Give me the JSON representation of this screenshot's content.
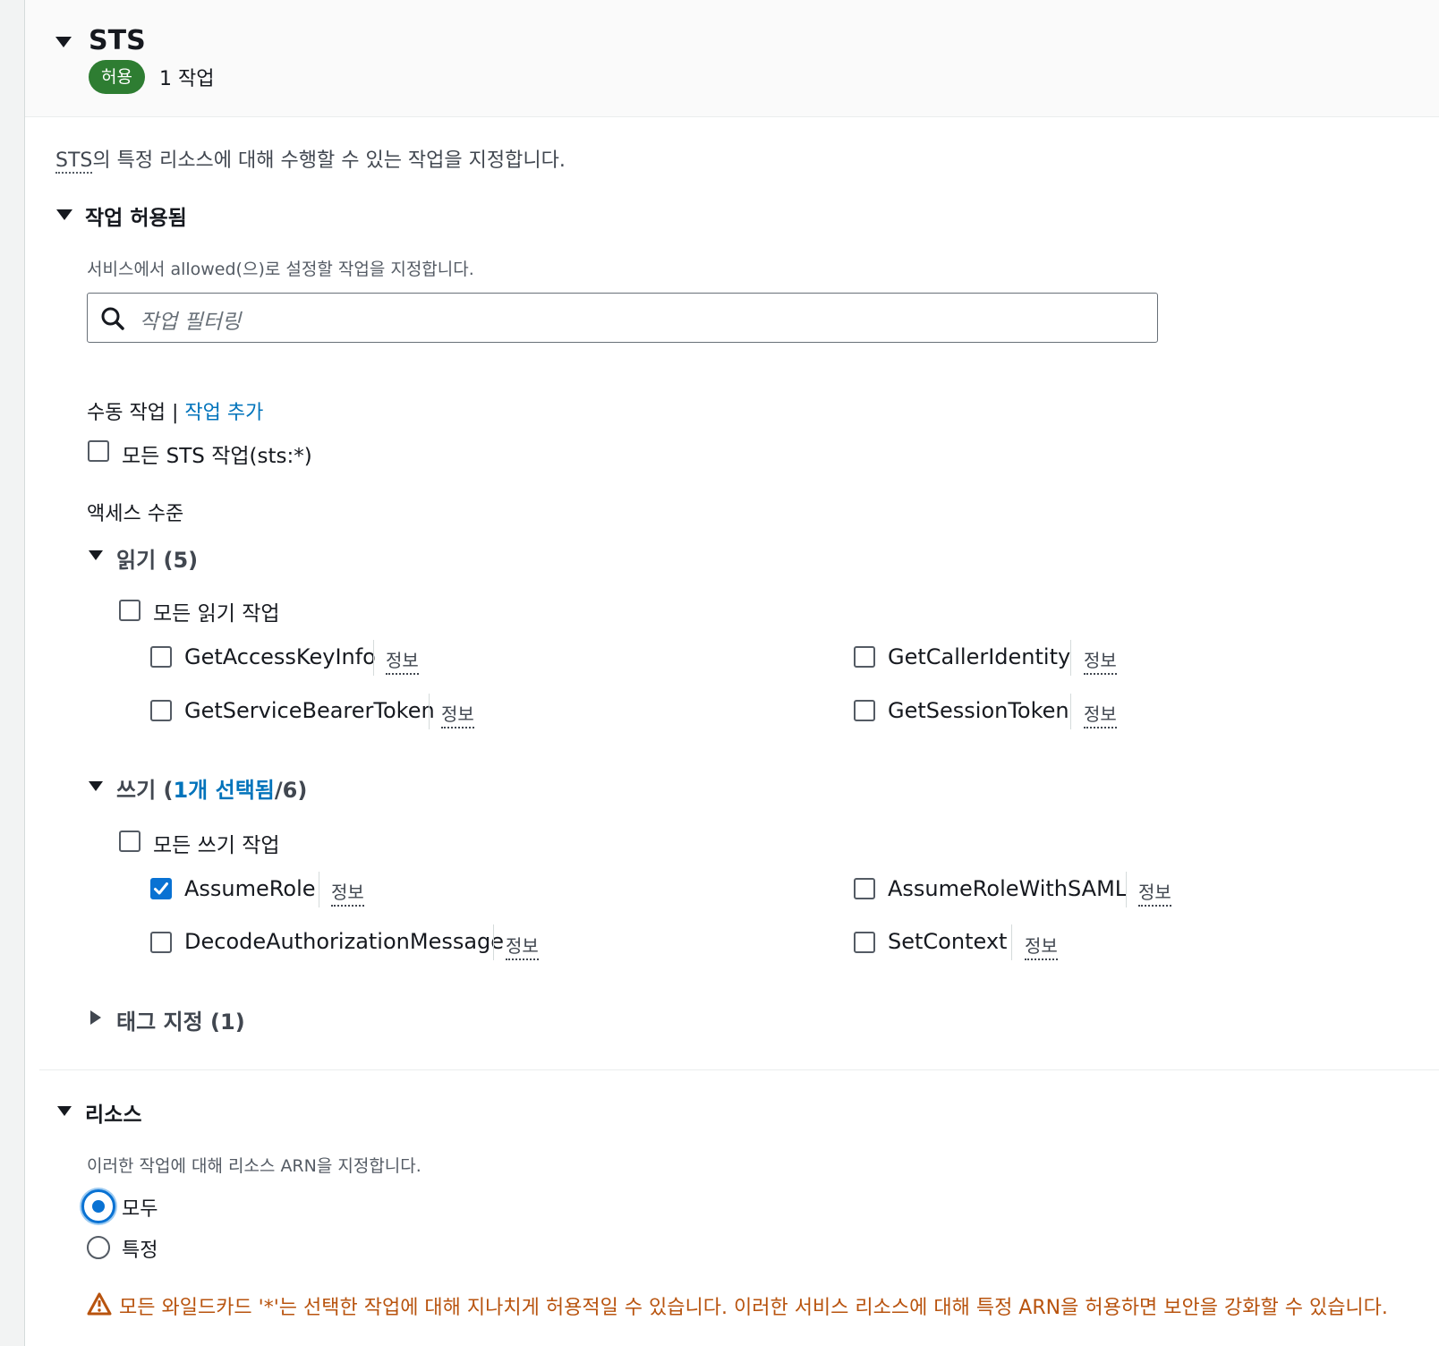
{
  "service": {
    "title": "STS",
    "badge": "허용",
    "action_count": "1 작업",
    "description_abbr": "STS",
    "description_rest": "의 특정 리소스에 대해 수행할 수 있는 작업을 지정합니다."
  },
  "actions_allowed": {
    "title": "작업 허용됨",
    "description": "서비스에서 allowed(으)로 설정할 작업을 지정합니다.",
    "filter_placeholder": "작업 필터링",
    "manual_label": "수동 작업",
    "separator": "|",
    "add_action_link": "작업 추가",
    "all_actions_label": "모든 STS 작업(sts:*)",
    "access_level_label": "액세스 수준"
  },
  "read_group": {
    "title": "읽기 (5)",
    "all_label": "모든 읽기 작업",
    "items": [
      {
        "name": "GetAccessKeyInfo",
        "info": "정보",
        "checked": false
      },
      {
        "name": "GetCallerIdentity",
        "info": "정보",
        "checked": false
      },
      {
        "name": "GetServiceBearerToken",
        "info": "정보",
        "checked": false
      },
      {
        "name": "GetSessionToken",
        "info": "정보",
        "checked": false
      }
    ]
  },
  "write_group": {
    "title_prefix": "쓰기 (",
    "title_selected": "1개 선택됨",
    "title_suffix": "/6)",
    "all_label": "모든 쓰기 작업",
    "items": [
      {
        "name": "AssumeRole",
        "info": "정보",
        "checked": true
      },
      {
        "name": "AssumeRoleWithSAML",
        "info": "정보",
        "checked": false
      },
      {
        "name": "DecodeAuthorizationMessage",
        "info": "정보",
        "checked": false
      },
      {
        "name": "SetContext",
        "info": "정보",
        "checked": false
      }
    ]
  },
  "tagging_group": {
    "title": "태그 지정 (1)"
  },
  "resources": {
    "title": "리소스",
    "description": "이러한 작업에 대해 리소스 ARN을 지정합니다.",
    "option_all": "모두",
    "option_specific": "특정",
    "selected": "모두",
    "warning": "모든 와일드카드 '*'는 선택한 작업에 대해 지나치게 허용적일 수 있습니다. 이러한 서비스 리소스에 대해 특정 ARN을 허용하면 보안을 강화할 수 있습니다."
  }
}
